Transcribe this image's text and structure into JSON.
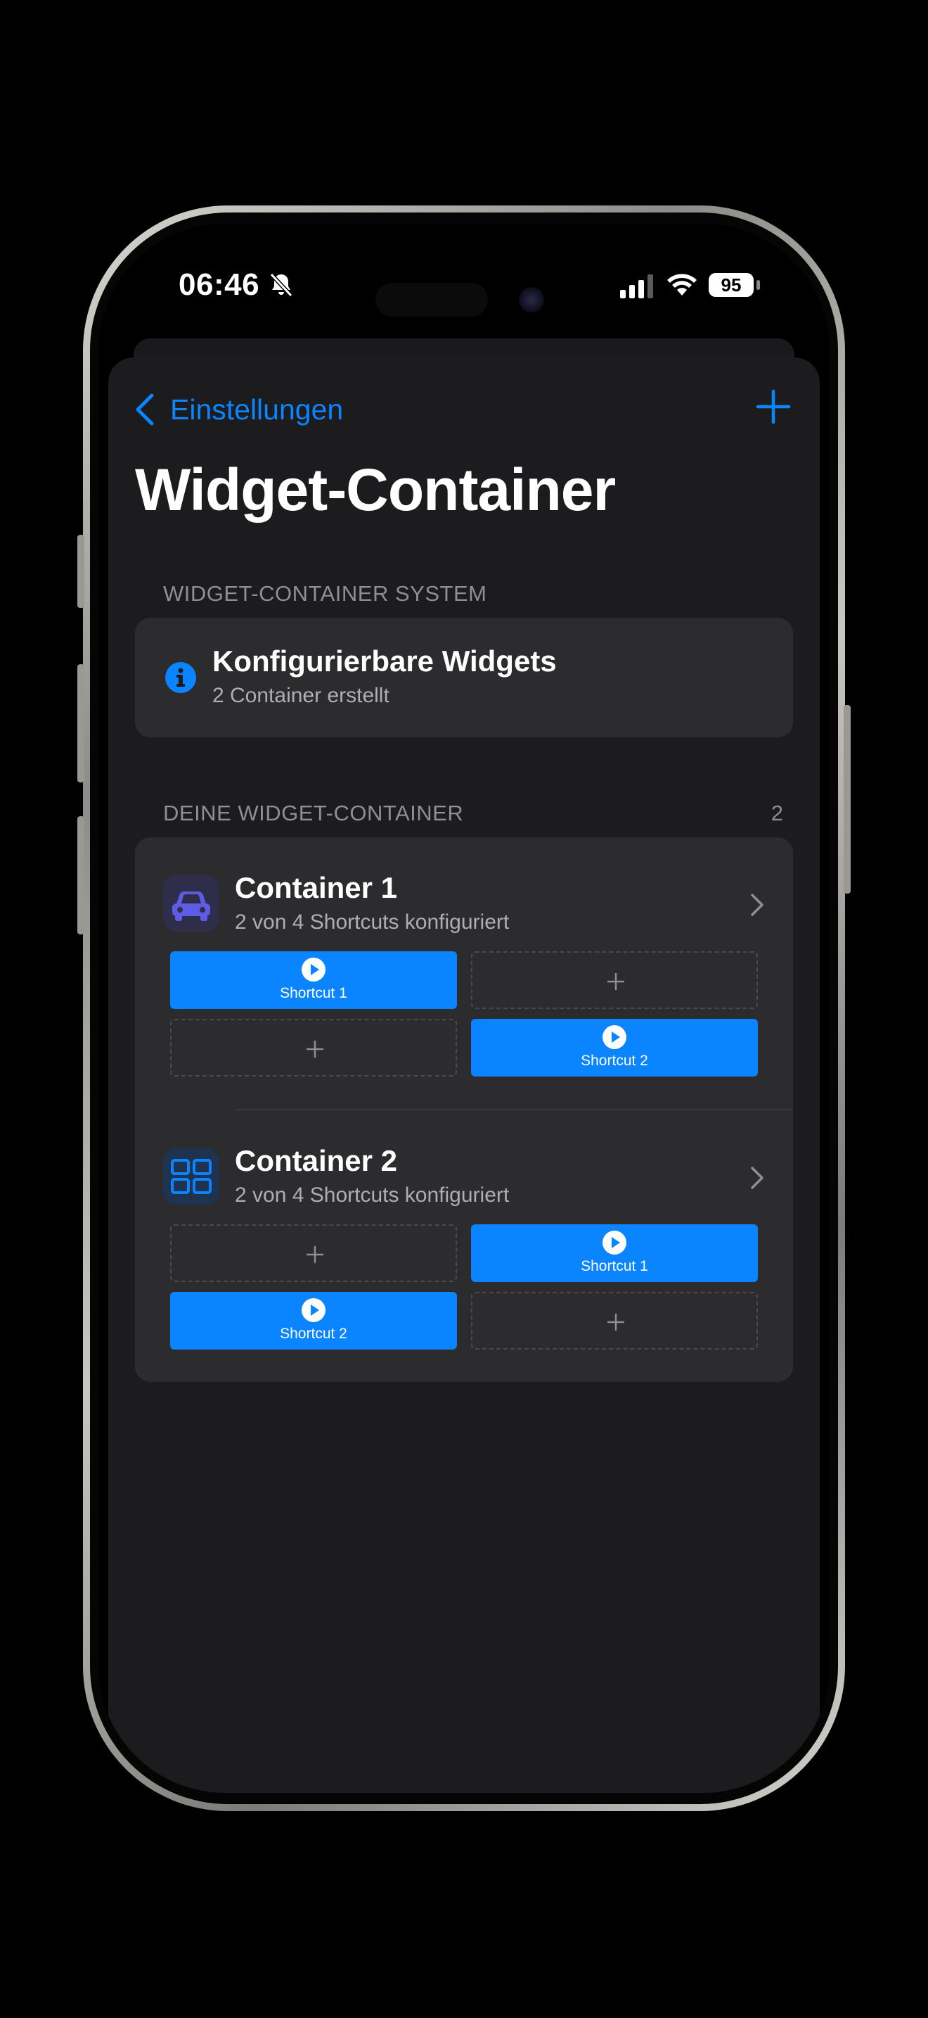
{
  "status_bar": {
    "time": "06:46",
    "battery": "95"
  },
  "nav": {
    "back_label": "Einstellungen",
    "title": "Widget-Container"
  },
  "system_section": {
    "header": "WIDGET-CONTAINER SYSTEM",
    "title": "Konfigurierbare Widgets",
    "subtitle": "2 Container erstellt"
  },
  "containers_section": {
    "header": "DEINE WIDGET-CONTAINER",
    "count": "2",
    "containers": [
      {
        "title": "Container 1",
        "subtitle": "2 von 4 Shortcuts konfiguriert",
        "icon": "car-icon",
        "slots": [
          {
            "filled": true,
            "label": "Shortcut 1"
          },
          {
            "filled": false,
            "label": ""
          },
          {
            "filled": false,
            "label": ""
          },
          {
            "filled": true,
            "label": "Shortcut 2"
          }
        ]
      },
      {
        "title": "Container 2",
        "subtitle": "2 von 4 Shortcuts konfiguriert",
        "icon": "grid-icon",
        "slots": [
          {
            "filled": false,
            "label": ""
          },
          {
            "filled": true,
            "label": "Shortcut 1"
          },
          {
            "filled": true,
            "label": "Shortcut 2"
          },
          {
            "filled": false,
            "label": ""
          }
        ]
      }
    ]
  },
  "colors": {
    "accent": "#0a84ff",
    "background": "#1c1c1e",
    "card": "#2c2c2e",
    "secondary_text": "#8e8e93",
    "car_icon": "#5e5ce6"
  }
}
